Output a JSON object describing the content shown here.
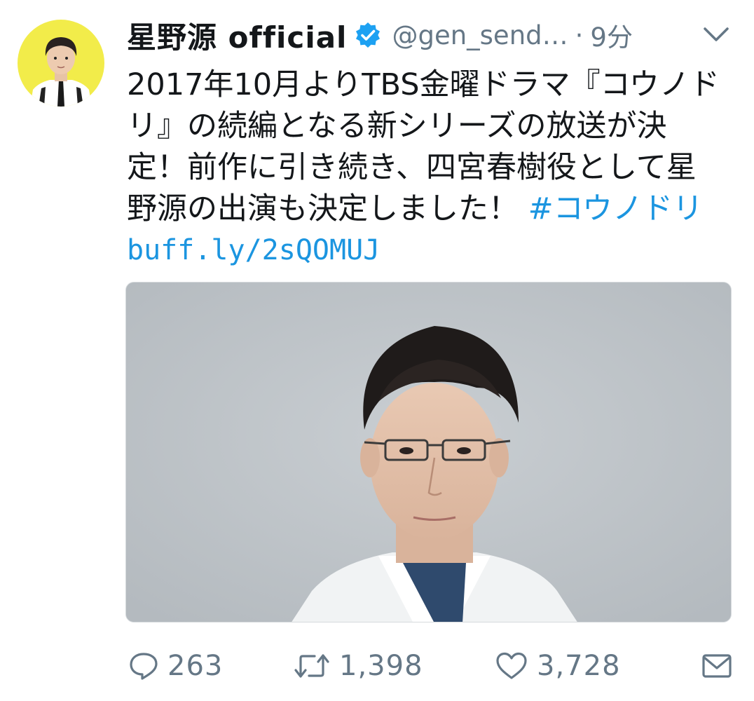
{
  "tweet": {
    "display_name": "星野源 official",
    "handle": "@gen_send…",
    "separator": "·",
    "time": "9分",
    "text_lines": [
      "2017年10月よりTBS金曜ドラマ『コウノド",
      "リ』の続編となる新シリーズの放送が決",
      "定！前作に引き続き、四宮春樹役として星",
      "野源の出演も決定しました！ "
    ],
    "hashtag": "#コウノドリ",
    "link": "buff.ly/2sQOMUJ"
  },
  "actions": {
    "reply_count": "263",
    "retweet_count": "1,398",
    "like_count": "3,728"
  },
  "icons": {
    "verified": "verified-badge-icon",
    "menu": "chevron-down-icon",
    "reply": "reply-icon",
    "retweet": "retweet-icon",
    "like": "heart-icon",
    "dm": "envelope-icon"
  },
  "colors": {
    "verified": "#1da1f2",
    "link": "#1b95e0",
    "muted": "#657786",
    "avatar_bg": "#f2ec4a",
    "media_bg": "#bcc2c7"
  }
}
